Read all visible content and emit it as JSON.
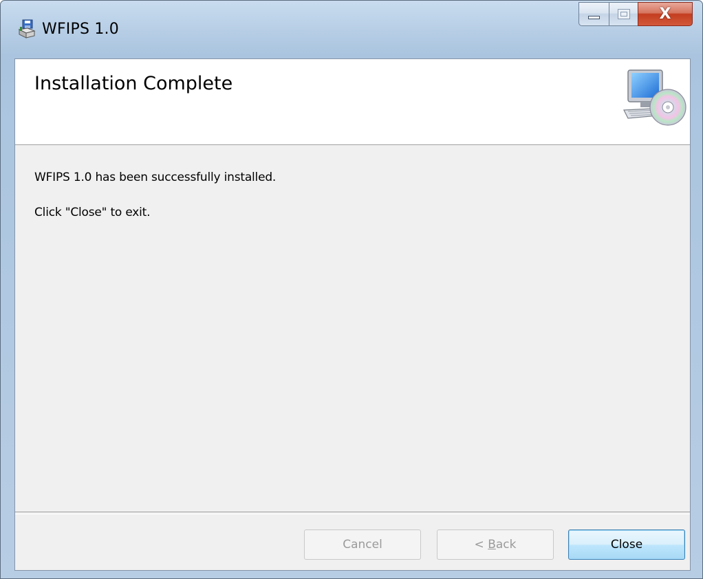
{
  "window": {
    "title": "WFIPS 1.0"
  },
  "caption_buttons": {
    "minimize_icon": "minimize-icon",
    "maximize_icon": "maximize-icon",
    "close_glyph": "X"
  },
  "banner": {
    "title": "Installation Complete",
    "icon": "computer-cd-icon"
  },
  "body": {
    "message_1": "WFIPS 1.0 has been successfully installed.",
    "message_2": "Click \"Close\" to exit."
  },
  "footer": {
    "cancel_label": "Cancel",
    "back_prefix": "< ",
    "back_accel": "B",
    "back_rest": "ack",
    "close_label": "Close"
  },
  "colors": {
    "title_bar": "#b8cfe6",
    "client_bg": "#f0f0f0",
    "close_button": "#c43e20",
    "default_button_border": "#3c7fb1"
  }
}
